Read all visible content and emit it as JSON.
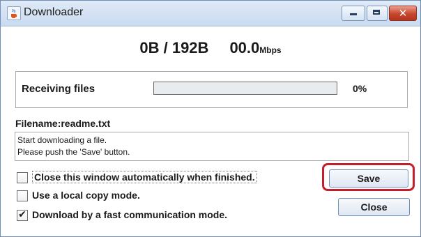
{
  "window": {
    "title": "Downloader",
    "app_icon": "java-cup-icon",
    "controls": {
      "minimize_icon": "minimize-icon",
      "maximize_icon": "maximize-icon",
      "close_icon": "close-icon",
      "close_glyph": "✕"
    }
  },
  "stats": {
    "transferred": "0B / 192B",
    "speed_value": "00.0",
    "speed_unit": "Mbps"
  },
  "progress": {
    "label": "Receiving files",
    "percent_text": "0%",
    "fraction": 0
  },
  "file": {
    "filename": "Filename:readme.txt"
  },
  "message": {
    "line1": "Start downloading a file.",
    "line2": "Please push the 'Save' button."
  },
  "options": [
    {
      "label": "Close this window automatically when finished.",
      "checked": false
    },
    {
      "label": "Use a local copy mode.",
      "checked": false
    },
    {
      "label": "Download by a fast communication mode.",
      "checked": true
    }
  ],
  "buttons": {
    "save_label": "Save",
    "close_label": "Close"
  },
  "colors": {
    "highlight": "#c01f2b",
    "titlebar": "#cfdff2",
    "close_button": "#c7452c"
  }
}
